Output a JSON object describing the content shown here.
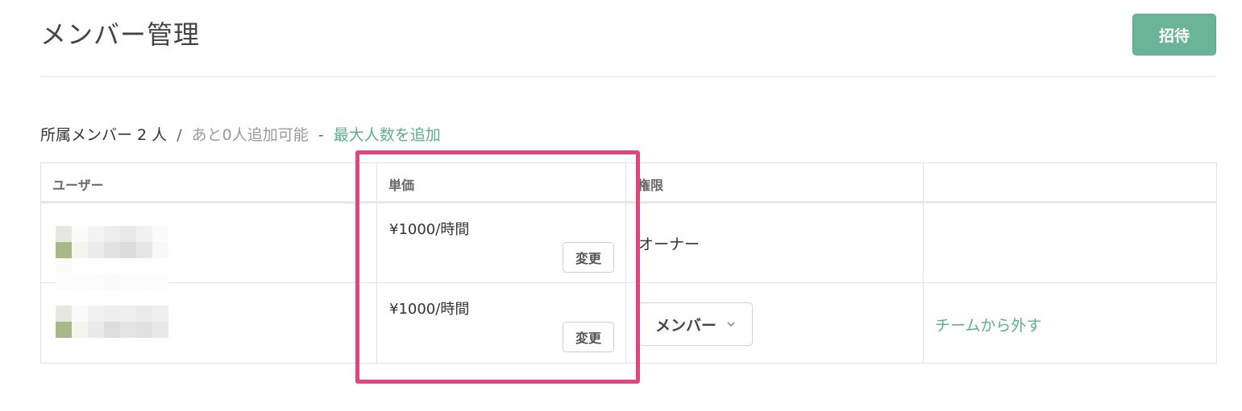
{
  "page": {
    "title": "メンバー管理"
  },
  "header": {
    "invite_label": "招待"
  },
  "summary": {
    "members_text": "所属メンバー 2 人",
    "separator": "/",
    "remaining_text": "あと0人追加可能",
    "dash": "-",
    "add_max_link": "最大人数を追加"
  },
  "table": {
    "headers": [
      "ユーザー",
      "単価",
      "権限",
      ""
    ],
    "rows": [
      {
        "price": "¥1000/時間",
        "change_label": "変更",
        "role": "オーナー",
        "role_select": "",
        "action": ""
      },
      {
        "price": "¥1000/時間",
        "change_label": "変更",
        "role": "",
        "role_select": "メンバー",
        "action": "チームから外す"
      }
    ]
  },
  "colors": {
    "accent": "#6cb497",
    "link": "#5fae8d",
    "highlight": "#e2457a",
    "mosaic_green": "#a8b886"
  },
  "icons": {
    "role_select_chevron": "chevron-down-icon"
  }
}
